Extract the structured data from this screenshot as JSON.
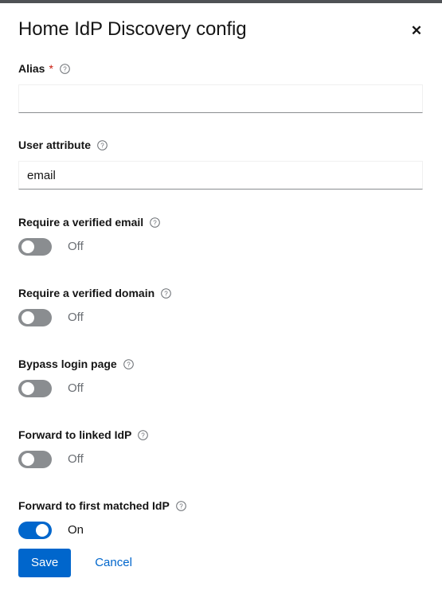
{
  "window": {
    "top_bar_color": "#4f5255"
  },
  "modal": {
    "title": "Home IdP Discovery config",
    "close_label": "✕",
    "accent_color": "#0066cc",
    "required_color": "#c9190b",
    "fields": [
      {
        "label": "Alias",
        "required": true,
        "help": "?",
        "value": "",
        "placeholder": ""
      },
      {
        "label": "User attribute",
        "required": false,
        "help": "?",
        "value": "email",
        "placeholder": ""
      }
    ],
    "switches": [
      {
        "label": "Require a verified email",
        "help": "?",
        "state": "Off",
        "on": false
      },
      {
        "label": "Require a verified domain",
        "help": "?",
        "state": "Off",
        "on": false
      },
      {
        "label": "Bypass login page",
        "help": "?",
        "state": "Off",
        "on": false
      },
      {
        "label": "Forward to linked IdP",
        "help": "?",
        "state": "Off",
        "on": false
      },
      {
        "label": "Forward to first matched IdP",
        "help": "?",
        "state": "On",
        "on": true
      }
    ],
    "footer": {
      "save_label": "Save",
      "cancel_label": "Cancel"
    }
  }
}
